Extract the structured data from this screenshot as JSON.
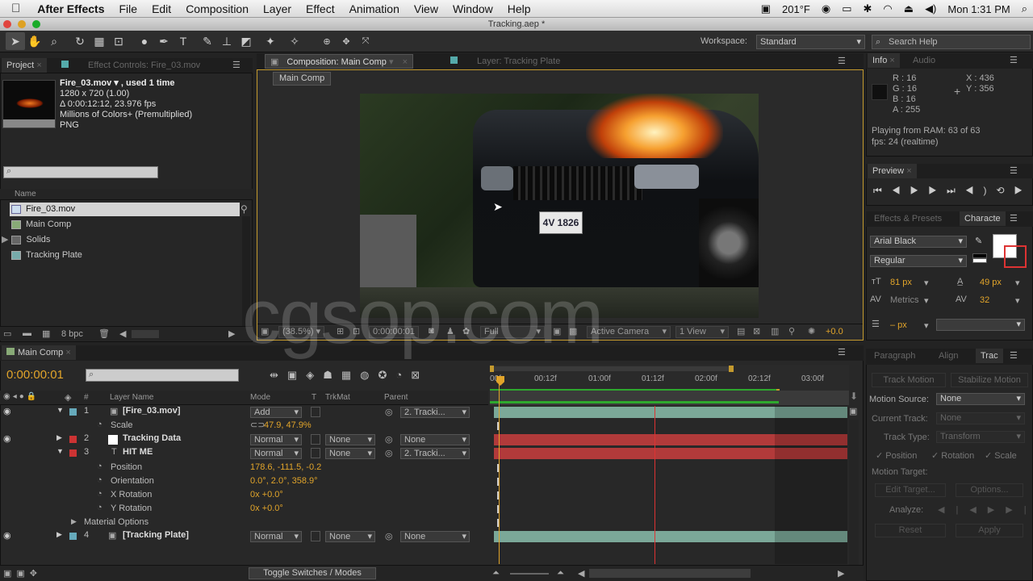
{
  "menubar": {
    "apple": "",
    "app": "After Effects",
    "items": [
      "File",
      "Edit",
      "Composition",
      "Layer",
      "Effect",
      "Animation",
      "View",
      "Window",
      "Help"
    ],
    "temp": "201°F",
    "clock": "Mon 1:31 PM"
  },
  "window_title": "Tracking.aep *",
  "workspace": {
    "label": "Workspace:",
    "value": "Standard"
  },
  "search_help": "Search Help",
  "project": {
    "tab": "Project",
    "tab2": "Effect Controls: Fire_03.mov",
    "footage_name": "Fire_03.mov ▾ , used 1 time",
    "info_lines": [
      "1280 x 720 (1.00)",
      "Δ 0:00:12:12, 23.976 fps",
      "Millions of Colors+ (Premultiplied)",
      "PNG"
    ],
    "col_name": "Name",
    "items": [
      "Fire_03.mov",
      "Main Comp",
      "Solids",
      "Tracking Plate"
    ],
    "bpc": "8 bpc"
  },
  "viewer": {
    "tab": "Composition: Main Comp",
    "tab2": "Layer: Tracking Plate",
    "crumb": "Main Comp",
    "zoom": "(38.5%)",
    "time": "0:00:00:01",
    "res": "Full",
    "camera": "Active Camera",
    "views": "1 View",
    "exposure": "+0.0",
    "plate": "4V 1826"
  },
  "info": {
    "tab": "Info",
    "tab2": "Audio",
    "r": "R : 16",
    "g": "G : 16",
    "b": "B : 16",
    "a": "A : 255",
    "x": "X : 436",
    "y": "Y : 356",
    "playing": "Playing from RAM: 63 of 63",
    "fps": "fps: 24 (realtime)"
  },
  "preview": {
    "tab": "Preview"
  },
  "character": {
    "tab1": "Effects & Presets",
    "tab2": "Characte",
    "font": "Arial Black",
    "style": "Regular",
    "size": "81 px",
    "leading": "49 px",
    "kerning": "Metrics",
    "tracking": "32",
    "stroke": "– px"
  },
  "tracker": {
    "tab1": "Paragraph",
    "tab2": "Align",
    "tab3": "Trac",
    "motion": "Track Motion",
    "stabilize": "Stabilize Motion",
    "src_label": "Motion Source:",
    "src_val": "None",
    "cur_label": "Current Track:",
    "cur_val": "None",
    "type_label": "Track Type:",
    "type_val": "Transform",
    "pos": "Position",
    "rot": "Rotation",
    "scale": "Scale",
    "target_label": "Motion Target:",
    "edit": "Edit Target...",
    "options": "Options...",
    "analyze": "Analyze:",
    "reset": "Reset",
    "apply": "Apply"
  },
  "timeline": {
    "tab": "Main Comp",
    "time": "0:00:00:01",
    "cols": {
      "layer": "Layer Name",
      "mode": "Mode",
      "t": "T",
      "trkmat": "TrkMat",
      "parent": "Parent"
    },
    "ruler": [
      "00f",
      "00:12f",
      "01:00f",
      "01:12f",
      "02:00f",
      "02:12f",
      "03:00f"
    ],
    "layers": [
      {
        "num": "1",
        "name": "[Fire_03.mov]",
        "mode": "Add",
        "trkmat": "",
        "parent": "2. Tracki..."
      },
      {
        "num": "2",
        "name": "Tracking Data",
        "mode": "Normal",
        "trkmat": "None",
        "parent": "None"
      },
      {
        "num": "3",
        "name": "HIT ME",
        "mode": "Normal",
        "trkmat": "None",
        "parent": "2. Tracki..."
      },
      {
        "num": "4",
        "name": "[Tracking Plate]",
        "mode": "Normal",
        "trkmat": "None",
        "parent": "None"
      }
    ],
    "props": {
      "scale": "Scale",
      "scale_v": "47.9, 47.9%",
      "position": "Position",
      "position_v": "178.6, -111.5, -0.2",
      "orient": "Orientation",
      "orient_v": "0.0°, 2.0°, 358.9°",
      "xrot": "X Rotation",
      "xrot_v": "0x +0.0°",
      "yrot": "Y Rotation",
      "yrot_v": "0x +0.0°",
      "material": "Material Options"
    },
    "toggle": "Toggle Switches / Modes"
  },
  "watermark": "cgsop.com"
}
